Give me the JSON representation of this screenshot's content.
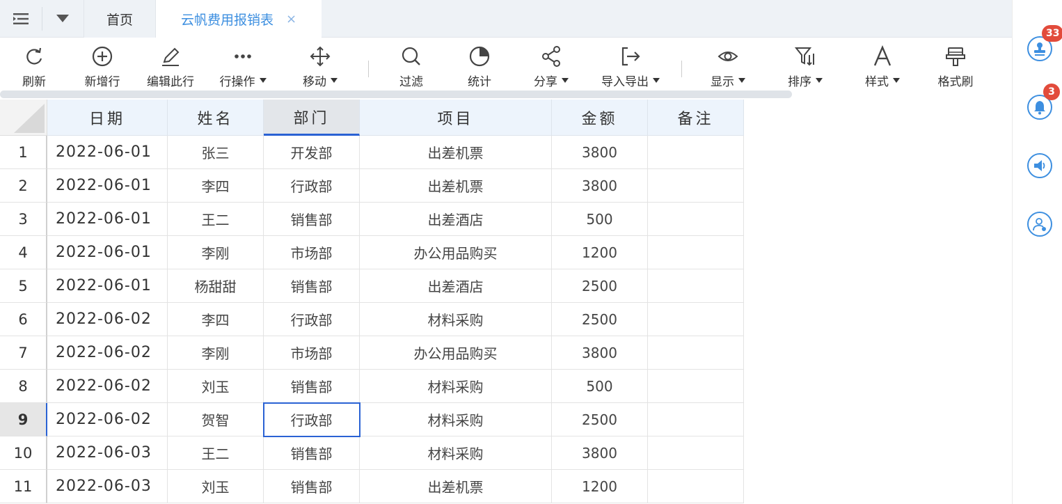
{
  "tabs": {
    "home": "首页",
    "active": "云帆费用报销表",
    "close": "×"
  },
  "toolbar": [
    {
      "label": "刷新",
      "icon": "refresh-icon",
      "dropdown": false
    },
    {
      "label": "新增行",
      "icon": "add-circle-icon",
      "dropdown": false
    },
    {
      "label": "编辑此行",
      "icon": "pencil-icon",
      "dropdown": false
    },
    {
      "label": "行操作",
      "icon": "more-dots-icon",
      "dropdown": true
    },
    {
      "label": "移动",
      "icon": "move-arrows-icon",
      "dropdown": true
    },
    {
      "label": "过滤",
      "icon": "search-icon",
      "dropdown": false
    },
    {
      "label": "统计",
      "icon": "pie-chart-icon",
      "dropdown": false
    },
    {
      "label": "分享",
      "icon": "share-icon",
      "dropdown": true
    },
    {
      "label": "导入导出",
      "icon": "export-icon",
      "dropdown": true
    },
    {
      "label": "显示",
      "icon": "eye-icon",
      "dropdown": true
    },
    {
      "label": "排序",
      "icon": "sort-filter-icon",
      "dropdown": true
    },
    {
      "label": "样式",
      "icon": "font-a-icon",
      "dropdown": true
    },
    {
      "label": "格式刷",
      "icon": "format-brush-icon",
      "dropdown": false
    }
  ],
  "table": {
    "columns": [
      "日期",
      "姓名",
      "部门",
      "项目",
      "金额",
      "备注"
    ],
    "selected_column": 2,
    "selected_row": 9,
    "rows": [
      {
        "num": "1",
        "cells": [
          "2022-06-01",
          "张三",
          "开发部",
          "出差机票",
          "3800",
          ""
        ]
      },
      {
        "num": "2",
        "cells": [
          "2022-06-01",
          "李四",
          "行政部",
          "出差机票",
          "3800",
          ""
        ]
      },
      {
        "num": "3",
        "cells": [
          "2022-06-01",
          "王二",
          "销售部",
          "出差酒店",
          "500",
          ""
        ]
      },
      {
        "num": "4",
        "cells": [
          "2022-06-01",
          "李刚",
          "市场部",
          "办公用品购买",
          "1200",
          ""
        ]
      },
      {
        "num": "5",
        "cells": [
          "2022-06-01",
          "杨甜甜",
          "销售部",
          "出差酒店",
          "2500",
          ""
        ]
      },
      {
        "num": "6",
        "cells": [
          "2022-06-02",
          "李四",
          "行政部",
          "材料采购",
          "2500",
          ""
        ]
      },
      {
        "num": "7",
        "cells": [
          "2022-06-02",
          "李刚",
          "市场部",
          "办公用品购买",
          "3800",
          ""
        ]
      },
      {
        "num": "8",
        "cells": [
          "2022-06-02",
          "刘玉",
          "销售部",
          "材料采购",
          "500",
          ""
        ]
      },
      {
        "num": "9",
        "cells": [
          "2022-06-02",
          "贺智",
          "行政部",
          "材料采购",
          "2500",
          ""
        ]
      },
      {
        "num": "10",
        "cells": [
          "2022-06-03",
          "王二",
          "销售部",
          "材料采购",
          "3800",
          ""
        ]
      },
      {
        "num": "11",
        "cells": [
          "2022-06-03",
          "刘玉",
          "销售部",
          "出差机票",
          "1200",
          ""
        ]
      }
    ]
  },
  "sidebar": {
    "items": [
      {
        "icon": "stamp-icon",
        "badge": "33"
      },
      {
        "icon": "bell-icon",
        "badge": "3"
      },
      {
        "icon": "speaker-icon",
        "badge": ""
      },
      {
        "icon": "user-settings-icon",
        "badge": ""
      }
    ]
  },
  "colors": {
    "accent": "#3d8fe0",
    "selection": "#2a62d4",
    "badge": "#e24b3b",
    "header_bg": "#edf4fc"
  }
}
